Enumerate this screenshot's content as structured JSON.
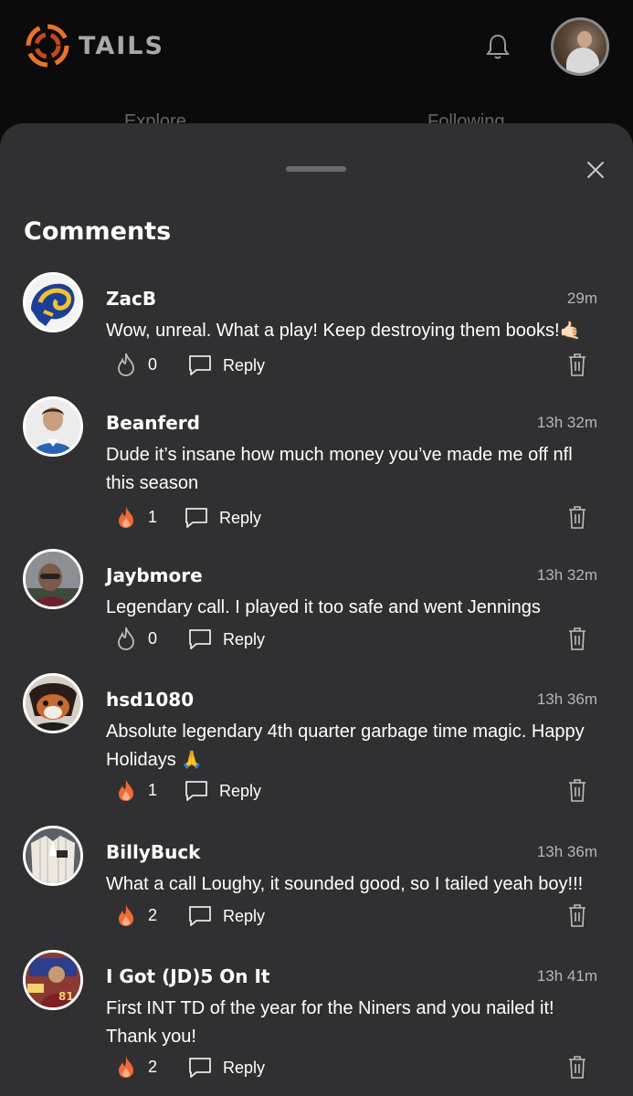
{
  "app": {
    "logo_text": "TAILS"
  },
  "behind_tabs": [
    "Explore",
    "Following"
  ],
  "sheet": {
    "title": "Comments"
  },
  "comments": [
    {
      "user": "ZacB",
      "time": "29m",
      "text": "Wow, unreal. What a play! Keep destroying them books!",
      "emoji": "🤙🏻",
      "fires": "0",
      "fire_active": false,
      "reply_label": "Reply",
      "avatar": "rams-logo"
    },
    {
      "user": "Beanferd",
      "time": "13h 32m",
      "text": "Dude it’s insane how much money you’ve made me off nfl this season",
      "emoji": "",
      "fires": "1",
      "fire_active": true,
      "reply_label": "Reply",
      "avatar": "player-photo"
    },
    {
      "user": "Jaybmore",
      "time": "13h 32m",
      "text": "Legendary call. I played it too safe and went Jennings",
      "emoji": "",
      "fires": "0",
      "fire_active": false,
      "reply_label": "Reply",
      "avatar": "selfie-photo"
    },
    {
      "user": "hsd1080",
      "time": "13h 36m",
      "text": "Absolute legendary 4th quarter garbage time magic. Happy Holidays",
      "emoji": "🙏",
      "fires": "1",
      "fire_active": true,
      "reply_label": "Reply",
      "avatar": "cartoon-avatar"
    },
    {
      "user": "BillyBuck",
      "time": "13h 36m",
      "text": "What a call Loughy, it sounded good, so I tailed yeah boy!!!",
      "emoji": "",
      "fires": "2",
      "fire_active": true,
      "reply_label": "Reply",
      "avatar": "jersey-photo"
    },
    {
      "user": "I Got (JD)5 On It",
      "time": "13h 41m",
      "text": "First INT TD of the year for the Niners and you nailed it!  Thank you!",
      "emoji": "",
      "fires": "2",
      "fire_active": true,
      "reply_label": "Reply",
      "avatar": "football-card"
    }
  ],
  "colors": {
    "fire_active": "#f06a35",
    "fire_inactive": "#bdbdbd",
    "sheet_bg": "#303032",
    "app_bg": "#0b0b0b"
  }
}
